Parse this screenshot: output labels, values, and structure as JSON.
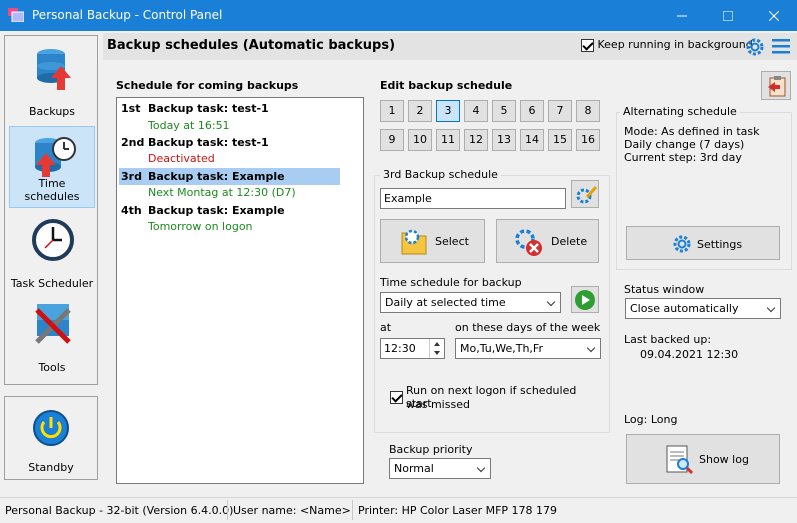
{
  "window": {
    "title": "Personal Backup - Control Panel"
  },
  "sidebar": {
    "items": [
      {
        "label": "Backups",
        "icon": "database-upload-icon"
      },
      {
        "label": "Time schedules",
        "icon": "database-clock-icon"
      },
      {
        "label": "Task Scheduler",
        "icon": "clock-icon"
      },
      {
        "label": "Tools",
        "icon": "tools-icon"
      }
    ],
    "standby": {
      "label": "Standby",
      "icon": "power-icon"
    }
  },
  "header": {
    "title": "Backup schedules (Automatic backups)",
    "keep_running_label": "Keep running in background",
    "keep_running_checked": true
  },
  "schedule_list": {
    "heading": "Schedule for coming backups",
    "items": [
      {
        "ordinal": "1st",
        "task": "Backup task: test-1",
        "status": "Today at 16:51",
        "status_color": "#1c8a1c"
      },
      {
        "ordinal": "2nd",
        "task": "Backup task: test-1",
        "status": "Deactivated",
        "status_color": "#d01010"
      },
      {
        "ordinal": "3rd",
        "task": "Backup task: Example",
        "status": "Next Montag at 12:30 (D7)",
        "status_color": "#1c8a1c"
      },
      {
        "ordinal": "4th",
        "task": "Backup task: Example",
        "status": "Tomorrow on logon",
        "status_color": "#1c8a1c"
      }
    ]
  },
  "edit": {
    "heading": "Edit backup schedule",
    "slots": [
      "1",
      "2",
      "3",
      "4",
      "5",
      "6",
      "7",
      "8",
      "9",
      "10",
      "11",
      "12",
      "13",
      "14",
      "15",
      "16"
    ],
    "active_slot": "3",
    "group_label": "3rd  Backup schedule",
    "name_value": "Example",
    "select_label": "Select",
    "delete_label": "Delete",
    "time_schedule_label": "Time schedule for backup",
    "time_schedule_value": "Daily at selected time",
    "at_label": "at",
    "time_value": "12:30",
    "days_label": "on these days of the week",
    "days_value": "Mo,Tu,We,Th,Fr",
    "run_on_logon_label_1": "Run on next logon if scheduled start",
    "run_on_logon_label_2": "was missed",
    "run_on_logon_checked": true
  },
  "alternating": {
    "title": "Alternating schedule",
    "mode": "Mode: As defined in task",
    "daily_change": "Daily change (7 days)",
    "current_step": "Current step: 3rd day",
    "settings_label": "Settings"
  },
  "status_window": {
    "label": "Status window",
    "value": "Close automatically"
  },
  "last_backed_up": {
    "label": "Last backed up:",
    "value": "09.04.2021 12:30"
  },
  "log": {
    "label": "Log: Long",
    "show_log_label": "Show log"
  },
  "priority": {
    "label": "Backup priority",
    "value": "Normal"
  },
  "statusbar": {
    "version": "Personal Backup - 32-bit (Version 6.4.0.0)",
    "user": "User name: <Name>",
    "printer": "Printer: HP Color Laser MFP 178 179"
  },
  "colors": {
    "titlebar": "#1a7fd6",
    "accent": "#0078d7",
    "active_nav": "#cce4f7"
  }
}
